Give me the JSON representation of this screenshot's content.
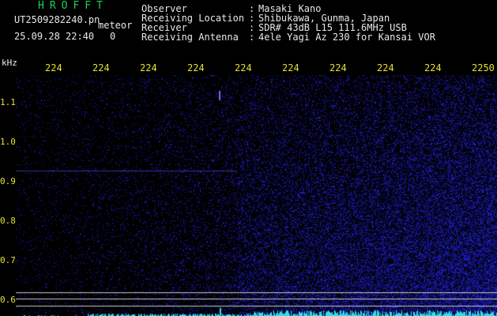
{
  "header": {
    "app_title": "HROFFT",
    "file_name": "UT2509282240.pn",
    "meteor_label": "meteor",
    "timestamp": "25.09.28 22:40",
    "status_mark": "0",
    "observer_key": "Observer",
    "observer_value": "Masaki Kano",
    "location_key": "Receiving Location",
    "location_value": "Shibukawa, Gunma, Japan",
    "receiver_key": "Receiver",
    "receiver_value": "SDR# 43dB L15 111.6MHz USB",
    "antenna_key": "Receiving Antenna",
    "antenna_value": "4ele Yagi Az 230 for Kansai VOR",
    "separator": ":"
  },
  "axis": {
    "unit_label": "kHz",
    "x_ticks": [
      "224",
      "224",
      "224",
      "224",
      "224",
      "224",
      "224",
      "224",
      "224",
      "2250"
    ],
    "y_ticks": [
      "1.1",
      "1.0",
      "0.9",
      "0.8",
      "0.7",
      "0.6"
    ]
  },
  "colors": {
    "background": "#000000",
    "header_text": "#e8e8e8",
    "title_text": "#1fd15a",
    "tick_text": "#e8e030",
    "noise": "#2a2ad0",
    "reference_line": "#c8c8c8",
    "signal": "#30e0e8"
  }
}
